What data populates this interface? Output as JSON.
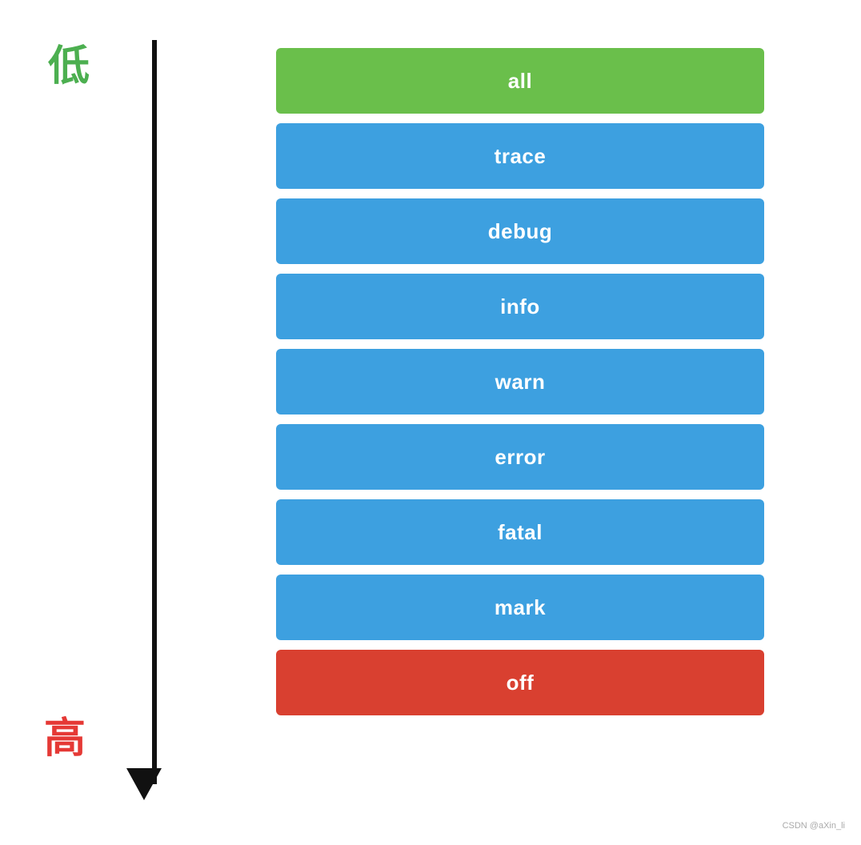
{
  "labels": {
    "low": "低",
    "high": "高"
  },
  "levels": [
    {
      "id": "all",
      "label": "all",
      "color": "green"
    },
    {
      "id": "trace",
      "label": "trace",
      "color": "blue"
    },
    {
      "id": "debug",
      "label": "debug",
      "color": "blue"
    },
    {
      "id": "info",
      "label": "info",
      "color": "blue"
    },
    {
      "id": "warn",
      "label": "warn",
      "color": "blue"
    },
    {
      "id": "error",
      "label": "error",
      "color": "blue"
    },
    {
      "id": "fatal",
      "label": "fatal",
      "color": "blue"
    },
    {
      "id": "mark",
      "label": "mark",
      "color": "blue"
    },
    {
      "id": "off",
      "label": "off",
      "color": "red"
    }
  ],
  "watermark": "CSDN @aXin_li"
}
